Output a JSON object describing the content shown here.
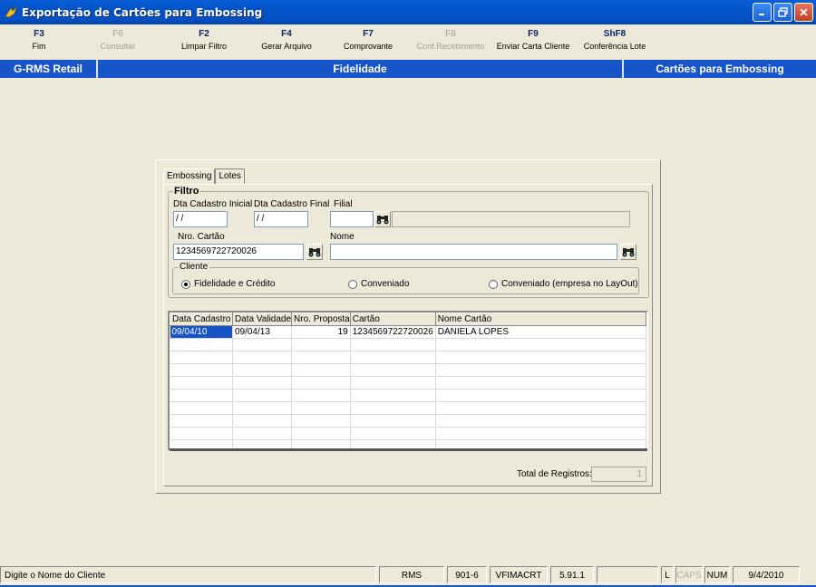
{
  "window": {
    "title": "Exportação de Cartões para Embossing"
  },
  "toolbar": {
    "keys": [
      {
        "key": "F3",
        "label": "Fim",
        "enabled": true
      },
      {
        "key": "F6",
        "label": "Consultar",
        "enabled": false
      },
      {
        "key": "F2",
        "label": "Limpar Filtro",
        "enabled": true
      },
      {
        "key": "F4",
        "label": "Gerar Arquivo",
        "enabled": true
      },
      {
        "key": "F7",
        "label": "Comprovante",
        "enabled": true
      },
      {
        "key": "F8",
        "label": "Conf.Recebimento",
        "enabled": false
      },
      {
        "key": "F9",
        "label": "Enviar Carta Cliente",
        "enabled": true
      },
      {
        "key": "ShF8",
        "label": "Conferência Lote",
        "enabled": true
      }
    ]
  },
  "header": {
    "left": "G-RMS Retail",
    "center": "Fidelidade",
    "right": "Cartões para Embossing"
  },
  "tabs": [
    {
      "label": "Embossing"
    },
    {
      "label": "Lotes"
    }
  ],
  "filtro": {
    "legend": "Filtro",
    "dta_cadastro_inicial_label": "Dta Cadastro Inicial",
    "dta_cadastro_inicial_value": " / /",
    "dta_cadastro_final_label": "Dta Cadastro Final",
    "dta_cadastro_final_value": " / /",
    "filial_label": "Filial",
    "filial_value": "",
    "filial_desc": "",
    "nro_cartao_label": "Nro. Cartão",
    "nro_cartao_value": "1234569722720026",
    "nome_label": "Nome",
    "nome_value": ""
  },
  "cliente": {
    "legend": "Cliente",
    "options": [
      {
        "label": "Fidelidade e Crédito",
        "selected": true
      },
      {
        "label": "Conveniado",
        "selected": false
      },
      {
        "label": "Conveniado (empresa no LayOut)",
        "selected": false
      }
    ]
  },
  "grid": {
    "columns": [
      "Data Cadastro",
      "Data Validade",
      "Nro. Proposta",
      "Cartão",
      "Nome Cartão"
    ],
    "rows": [
      [
        "09/04/10",
        "09/04/13",
        "19",
        "1234569722720026",
        "DANIELA LOPES"
      ]
    ]
  },
  "total": {
    "label": "Total de Registros:",
    "value": "1"
  },
  "statusbar": {
    "message": "Digite o Nome do Cliente",
    "system": "RMS",
    "code": "901-6",
    "program": "VFIMACRT",
    "version": "5.91.1",
    "blank": "",
    "l": "L",
    "caps": "CAPS",
    "num": "NUM",
    "date": "9/4/2010"
  }
}
